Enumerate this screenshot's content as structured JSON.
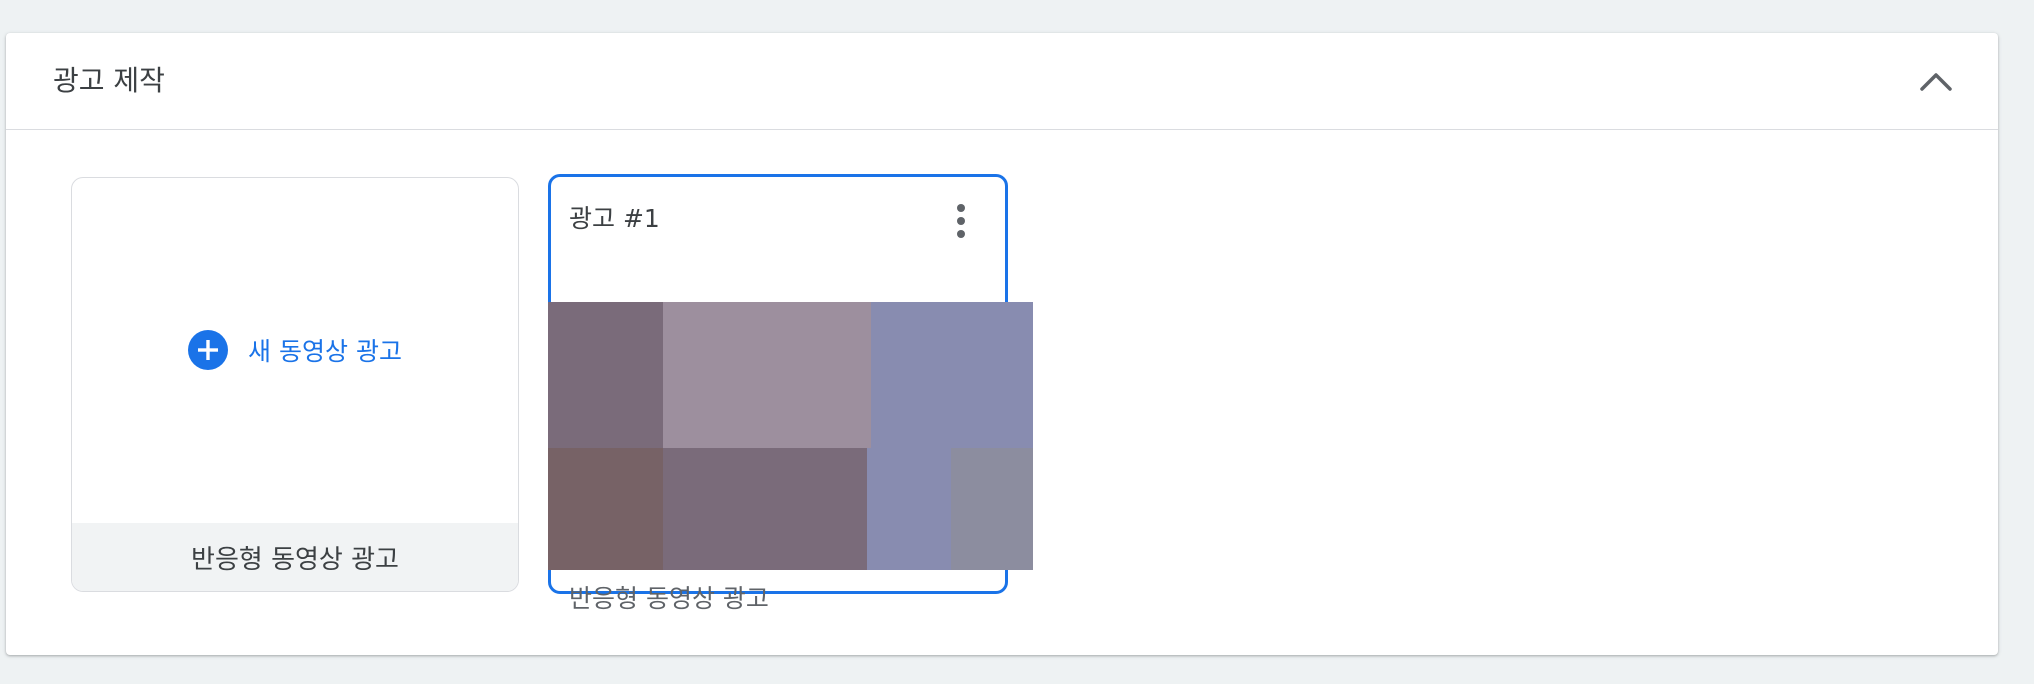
{
  "section": {
    "title": "광고 제작",
    "collapse_icon": "chevron-up-icon"
  },
  "new_card": {
    "button_label": "새 동영상 광고",
    "button_icon": "add-circle-icon",
    "footer_label": "반응형 동영상 광고"
  },
  "ad_card": {
    "title": "광고 #1",
    "menu_icon": "more-vert-icon",
    "subtitle": "반응형 동영상 광고"
  },
  "colors": {
    "accent": "#1a73e8",
    "panel_bg": "#ffffff",
    "page_bg": "#eef2f3",
    "card_footer_bg": "#f1f3f4",
    "text_primary": "#3c4043",
    "text_secondary": "#5f6368",
    "icon": "#5f6368"
  }
}
